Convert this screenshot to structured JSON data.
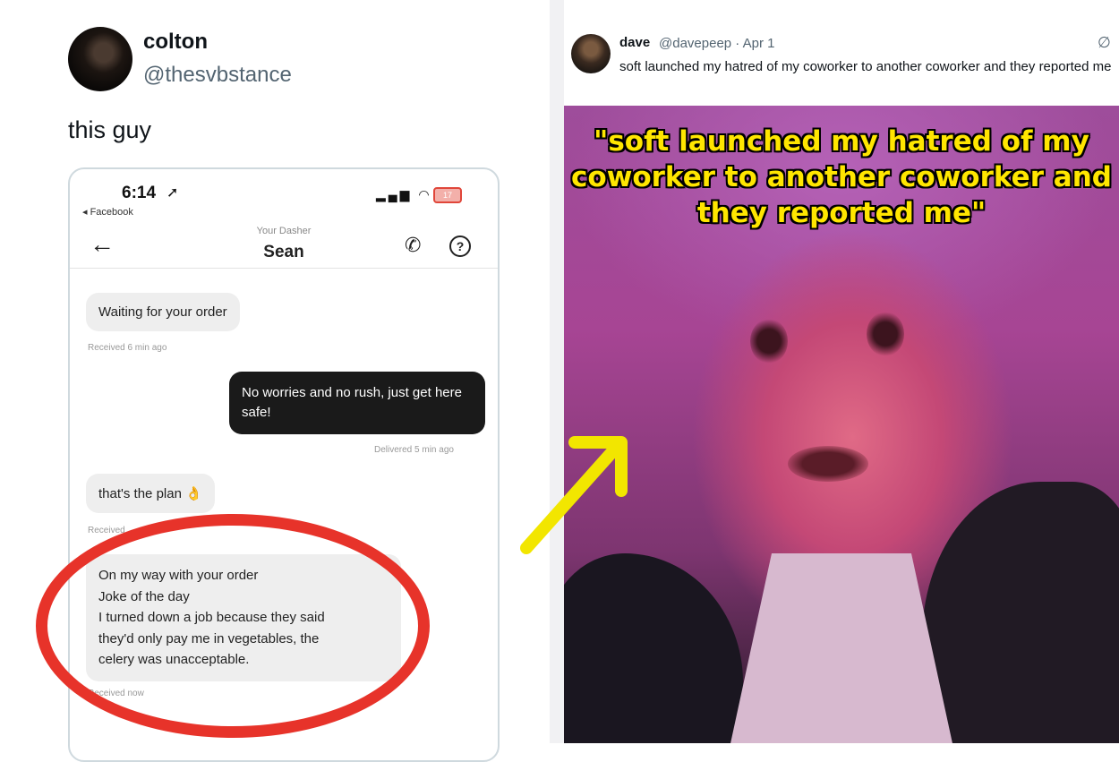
{
  "left_tweet": {
    "name": "colton",
    "handle": "@thesvbstance",
    "text": "this guy"
  },
  "phone": {
    "status_time": "6:14",
    "status_back": "◂ Facebook",
    "battery": "17",
    "dasher_sub": "Your Dasher",
    "dasher_name": "Sean",
    "messages": [
      {
        "text": "Waiting for your order",
        "meta": "Received 6 min ago"
      },
      {
        "text": "No worries and no rush, just get here safe!",
        "meta": "Delivered 5 min ago"
      },
      {
        "text": "that's the plan 👌",
        "meta": "Received"
      },
      {
        "lines": [
          "On my way with your order",
          "Joke of the day",
          "I turned down a job because they said",
          "they'd only pay me in vegetables, the",
          "celery was unacceptable."
        ],
        "meta": "Received now"
      }
    ]
  },
  "right_tweet": {
    "name": "dave",
    "meta": "@davepeep · Apr 1",
    "text": "soft launched my hatred of my coworker to another coworker and they reported me"
  },
  "meme": {
    "caption": "\"soft launched my hatred of my coworker to another coworker and they reported me\""
  },
  "colors": {
    "oval": "#e7332a",
    "arrow": "#f2e600",
    "caption": "#ffe600"
  }
}
